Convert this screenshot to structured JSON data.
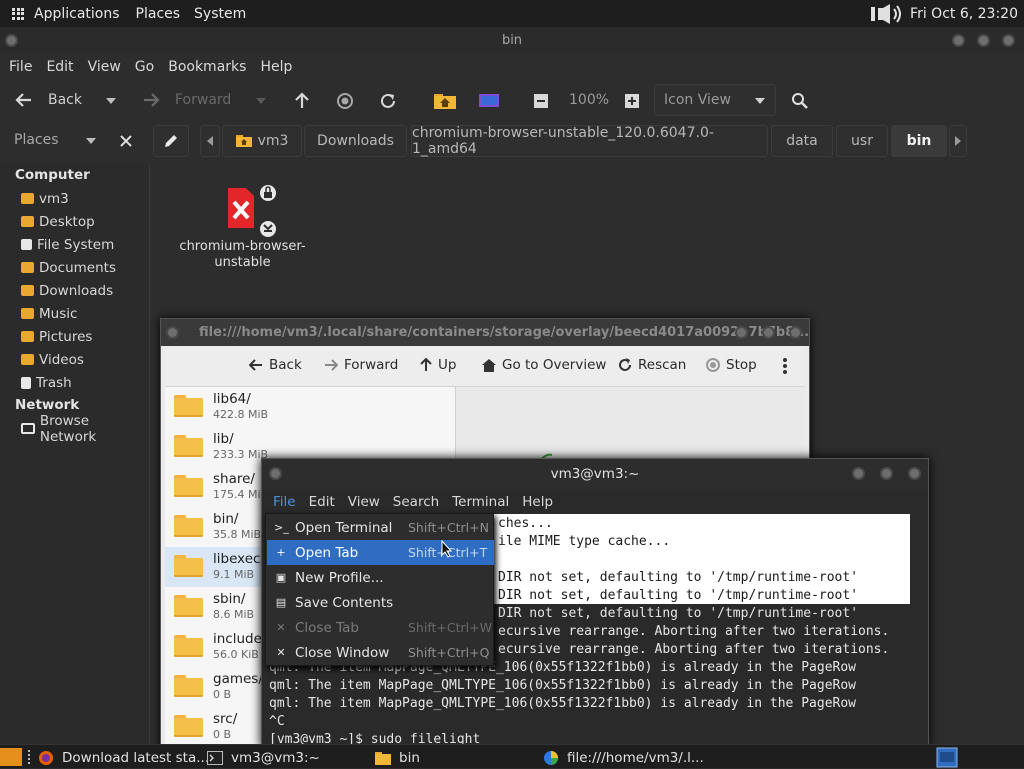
{
  "top_panel": {
    "applications": "Applications",
    "places": "Places",
    "system": "System",
    "clock": "Fri Oct  6, 23:20"
  },
  "file_manager": {
    "title": "bin",
    "menubar": [
      "File",
      "Edit",
      "View",
      "Go",
      "Bookmarks",
      "Help"
    ],
    "toolbar": {
      "back": "Back",
      "forward": "Forward",
      "zoom": "100%",
      "view_mode": "Icon View"
    },
    "places_select": "Places",
    "breadcrumbs": [
      "vm3",
      "Downloads",
      "chromium-browser-unstable_120.0.6047.0-1_amd64",
      "data",
      "usr",
      "bin"
    ],
    "sidebar": {
      "computer_header": "Computer",
      "items": [
        "vm3",
        "Desktop",
        "File System",
        "Documents",
        "Downloads",
        "Music",
        "Pictures",
        "Videos",
        "Trash"
      ],
      "network_header": "Network",
      "network_items": [
        "Browse Network"
      ]
    },
    "files": [
      {
        "name_line1": "chromium-browser-",
        "name_line2": "unstable"
      }
    ]
  },
  "overlay_window": {
    "title": "file:///home/vm3/.local/share/containers/storage/overlay/beecd4017a0092b7b7b8...",
    "toolbar": [
      "Back",
      "Forward",
      "Up",
      "Go to Overview",
      "Rescan",
      "Stop"
    ],
    "entries": [
      {
        "name": "lib64/",
        "size": "422.8 MiB"
      },
      {
        "name": "lib/",
        "size": "233.3 MiB"
      },
      {
        "name": "share/",
        "size": "175.4 MiB"
      },
      {
        "name": "bin/",
        "size": "35.8 MiB"
      },
      {
        "name": "libexec/",
        "size": "9.1 MiB"
      },
      {
        "name": "sbin/",
        "size": "8.6 MiB"
      },
      {
        "name": "include/",
        "size": "56.0 KiB"
      },
      {
        "name": "games/",
        "size": "0 B"
      },
      {
        "name": "src/",
        "size": "0 B"
      }
    ]
  },
  "terminal": {
    "title": "vm3@vm3:~",
    "menubar": [
      "File",
      "Edit",
      "View",
      "Search",
      "Terminal",
      "Help"
    ],
    "lines": [
      "ches...",
      "ile MIME type cache...",
      "",
      "DIR not set, defaulting to '/tmp/runtime-root'",
      "DIR not set, defaulting to '/tmp/runtime-root'",
      "DIR not set, defaulting to '/tmp/runtime-root'",
      "ecursive rearrange. Aborting after two iterations.",
      "ecursive rearrange. Aborting after two iterations.",
      "qml: The item MapPage_QMLTYPE_106(0x55f1322f1bb0) is already in the PageRow",
      "qml: The item MapPage_QMLTYPE_106(0x55f1322f1bb0) is already in the PageRow",
      "qml: The item MapPage_QMLTYPE_106(0x55f1322f1bb0) is already in the PageRow",
      "^C",
      "[vm3@vm3 ~]$ sudo filelight"
    ],
    "file_menu": [
      {
        "label": "Open Terminal",
        "accel": "Shift+Ctrl+N",
        "icon": ">_",
        "state": "normal"
      },
      {
        "label": "Open Tab",
        "accel": "Shift+Ctrl+T",
        "icon": "+",
        "state": "highlight"
      },
      {
        "label": "New Profile...",
        "accel": "",
        "icon": "▣",
        "state": "normal"
      },
      {
        "label": "Save Contents",
        "accel": "",
        "icon": "▤",
        "state": "normal"
      },
      {
        "label": "Close Tab",
        "accel": "Shift+Ctrl+W",
        "icon": "✕",
        "state": "disabled"
      },
      {
        "label": "Close Window",
        "accel": "Shift+Ctrl+Q",
        "icon": "✕",
        "state": "normal"
      }
    ]
  },
  "taskbar": {
    "tasks": [
      "Download latest sta...",
      "vm3@vm3:~",
      "bin",
      "file:///home/vm3/.l..."
    ]
  },
  "colors": {
    "accent": "#2e6dc2",
    "folder": "#f5c04a",
    "panel": "#1e1e1e"
  }
}
